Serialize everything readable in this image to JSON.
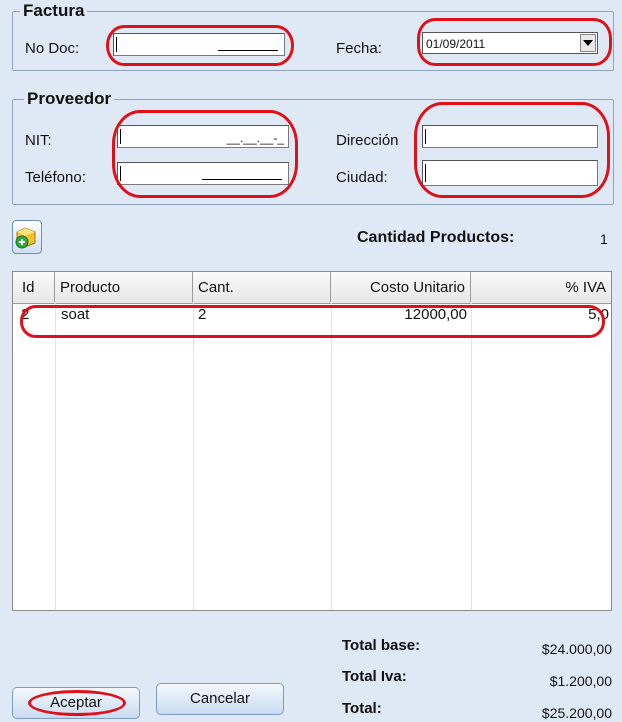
{
  "factura": {
    "legend": "Factura",
    "no_doc_label": "No Doc:",
    "fecha_label": "Fecha:",
    "fecha_value": "01/09/2011"
  },
  "proveedor": {
    "legend": "Proveedor",
    "nit_label": "NIT:",
    "nit_mask": "__.__.__-_",
    "telefono_label": "Teléfono:",
    "direccion_label": "Dirección",
    "ciudad_label": "Ciudad:"
  },
  "cantidad_productos": {
    "label": "Cantidad Productos:",
    "value": "1"
  },
  "grid": {
    "columns": [
      "Id",
      "Producto",
      "Cant.",
      "Costo Unitario",
      "% IVA"
    ],
    "rows": [
      {
        "id": "2",
        "producto": "soat",
        "cant": "2",
        "costo": "12000,00",
        "iva": "5,0"
      }
    ]
  },
  "totals": {
    "base_label": "Total base:",
    "base_value": "$24.000,00",
    "iva_label": "Total Iva:",
    "iva_value": "$1.200,00",
    "total_label": "Total:",
    "total_value": "$25.200,00"
  },
  "buttons": {
    "aceptar": "Aceptar",
    "cancelar": "Cancelar"
  },
  "annotation_color": "#e0101b"
}
